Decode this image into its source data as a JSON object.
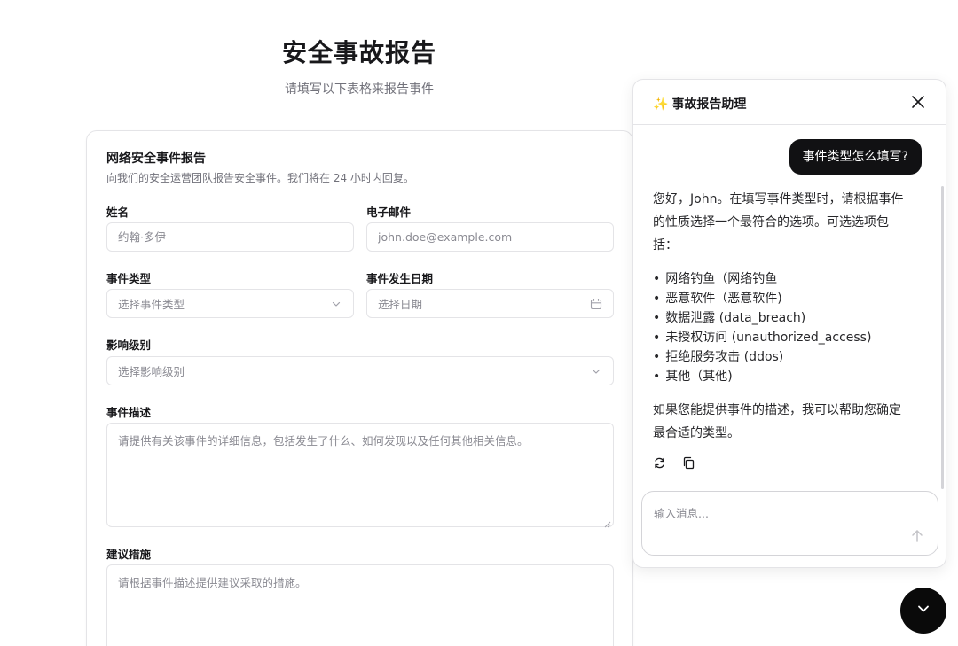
{
  "page": {
    "title": "安全事故报告",
    "subtitle": "请填写以下表格来报告事件"
  },
  "form": {
    "title": "网络安全事件报告",
    "description": "向我们的安全运营团队报告安全事件。我们将在 24 小时内回复。",
    "name_label": "姓名",
    "name_placeholder": "约翰·多伊",
    "email_label": "电子邮件",
    "email_placeholder": "john.doe@example.com",
    "type_label": "事件类型",
    "type_placeholder": "选择事件类型",
    "date_label": "事件发生日期",
    "date_placeholder": "选择日期",
    "severity_label": "影响级别",
    "severity_placeholder": "选择影响级别",
    "description_label": "事件描述",
    "description_placeholder": "请提供有关该事件的详细信息，包括发生了什么、如何发现以及任何其他相关信息。",
    "actions_label": "建议措施",
    "actions_placeholder": "请根据事件描述提供建议采取的措施。"
  },
  "chat": {
    "title": "事故报告助理",
    "title_icon": "sparkles-icon",
    "user_message": "事件类型怎么填写?",
    "assistant_intro": "您好，John。在填写事件类型时，请根据事件的性质选择一个最符合的选项。可选选项包括：",
    "options": [
      "网络钓鱼（网络钓鱼",
      "恶意软件（恶意软件)",
      "数据泄露 (data_breach)",
      "未授权访问 (unauthorized_access)",
      "拒绝服务攻击 (ddos)",
      "其他（其他)"
    ],
    "assistant_outro": "如果您能提供事件的描述，我可以帮助您确定最合适的类型。",
    "input_placeholder": "输入消息..."
  },
  "colors": {
    "accent": "#111113",
    "border": "#e4e4e7",
    "muted": "#71717a"
  }
}
